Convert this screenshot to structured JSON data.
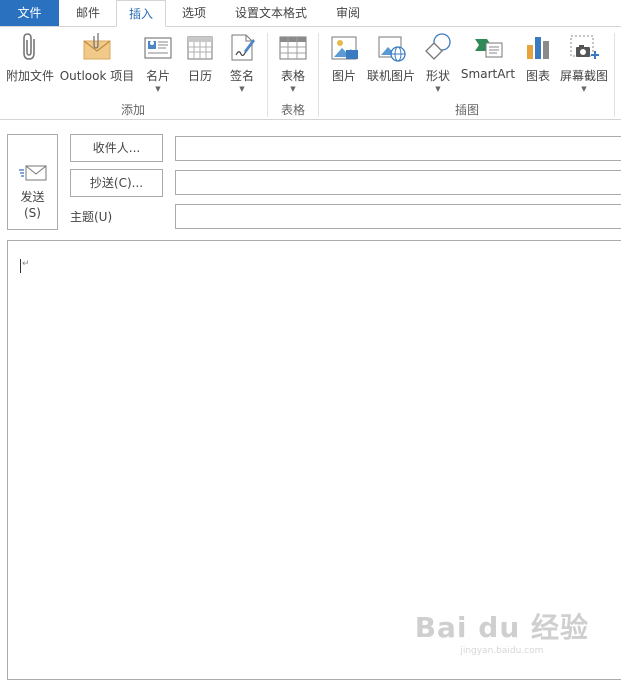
{
  "tabs": [
    {
      "label": "文件"
    },
    {
      "label": "邮件"
    },
    {
      "label": "插入"
    },
    {
      "label": "选项"
    },
    {
      "label": "设置文本格式"
    },
    {
      "label": "审阅"
    }
  ],
  "ribbon": {
    "add_group": {
      "label": "添加",
      "buttons": [
        {
          "label": "附加文件",
          "icon": "paperclip-icon"
        },
        {
          "label": "Outlook 项目",
          "icon": "envelope-icon"
        },
        {
          "label": "名片",
          "icon": "business-card-icon"
        },
        {
          "label": "日历",
          "icon": "calendar-icon"
        },
        {
          "label": "签名",
          "icon": "signature-icon"
        }
      ]
    },
    "table_group": {
      "label": "表格",
      "buttons": [
        {
          "label": "表格",
          "icon": "table-icon"
        }
      ]
    },
    "illustrations_group": {
      "label": "插图",
      "buttons": [
        {
          "label": "图片",
          "icon": "picture-icon"
        },
        {
          "label": "联机图片",
          "icon": "online-picture-icon"
        },
        {
          "label": "形状",
          "icon": "shapes-icon"
        },
        {
          "label": "SmartArt",
          "icon": "smartart-icon"
        },
        {
          "label": "图表",
          "icon": "chart-icon"
        },
        {
          "label": "屏幕截图",
          "icon": "screenshot-icon"
        }
      ]
    }
  },
  "header": {
    "send": {
      "line1": "发送",
      "line2": "(S)"
    },
    "to_button": "收件人...",
    "cc_button": "抄送(C)...",
    "subject_label": "主题(U)",
    "to_value": "",
    "cc_value": "",
    "subject_value": ""
  },
  "body": {
    "para_mark": "↵"
  },
  "watermark": {
    "line1": "Bai du 经验",
    "line2": "jingyan.baidu.com"
  },
  "colors": {
    "file_tab": "#2a72c0",
    "active_tab_text": "#2b6fb8",
    "border": "#ababab"
  }
}
